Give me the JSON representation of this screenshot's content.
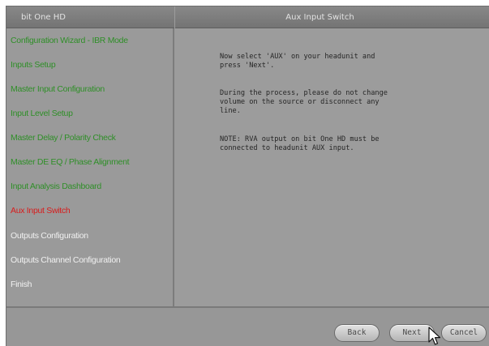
{
  "window": {
    "left_title": "bit One HD",
    "right_title": "Aux Input Switch"
  },
  "sidebar": {
    "items": [
      {
        "label": "Configuration Wizard - IBR Mode",
        "status": "done"
      },
      {
        "label": "Inputs Setup",
        "status": "done"
      },
      {
        "label": "Master Input Configuration",
        "status": "done"
      },
      {
        "label": "Input Level Setup",
        "status": "done"
      },
      {
        "label": "Master Delay / Polarity Check",
        "status": "done"
      },
      {
        "label": "Master DE EQ / Phase Alignment",
        "status": "done"
      },
      {
        "label": "Input Analysis Dashboard",
        "status": "done"
      },
      {
        "label": "Aux Input Switch",
        "status": "current"
      },
      {
        "label": "Outputs Configuration",
        "status": "pending"
      },
      {
        "label": "Outputs Channel Configuration",
        "status": "pending"
      },
      {
        "label": "Finish",
        "status": "pending"
      }
    ]
  },
  "content": {
    "messages": [
      "Now select 'AUX' on your headunit and\npress 'Next'.",
      "During the process, please do not change\nvolume on the source or disconnect any\nline.",
      "NOTE: RVA output on bit One HD must be\nconnected to headunit AUX input."
    ]
  },
  "footer": {
    "back_label": "Back",
    "next_label": "Next",
    "cancel_label": "Cancel"
  },
  "colors": {
    "done": "#2f8f28",
    "current": "#d81c1c",
    "pending": "#f0f0f0",
    "panel": "#9c9c9c"
  }
}
